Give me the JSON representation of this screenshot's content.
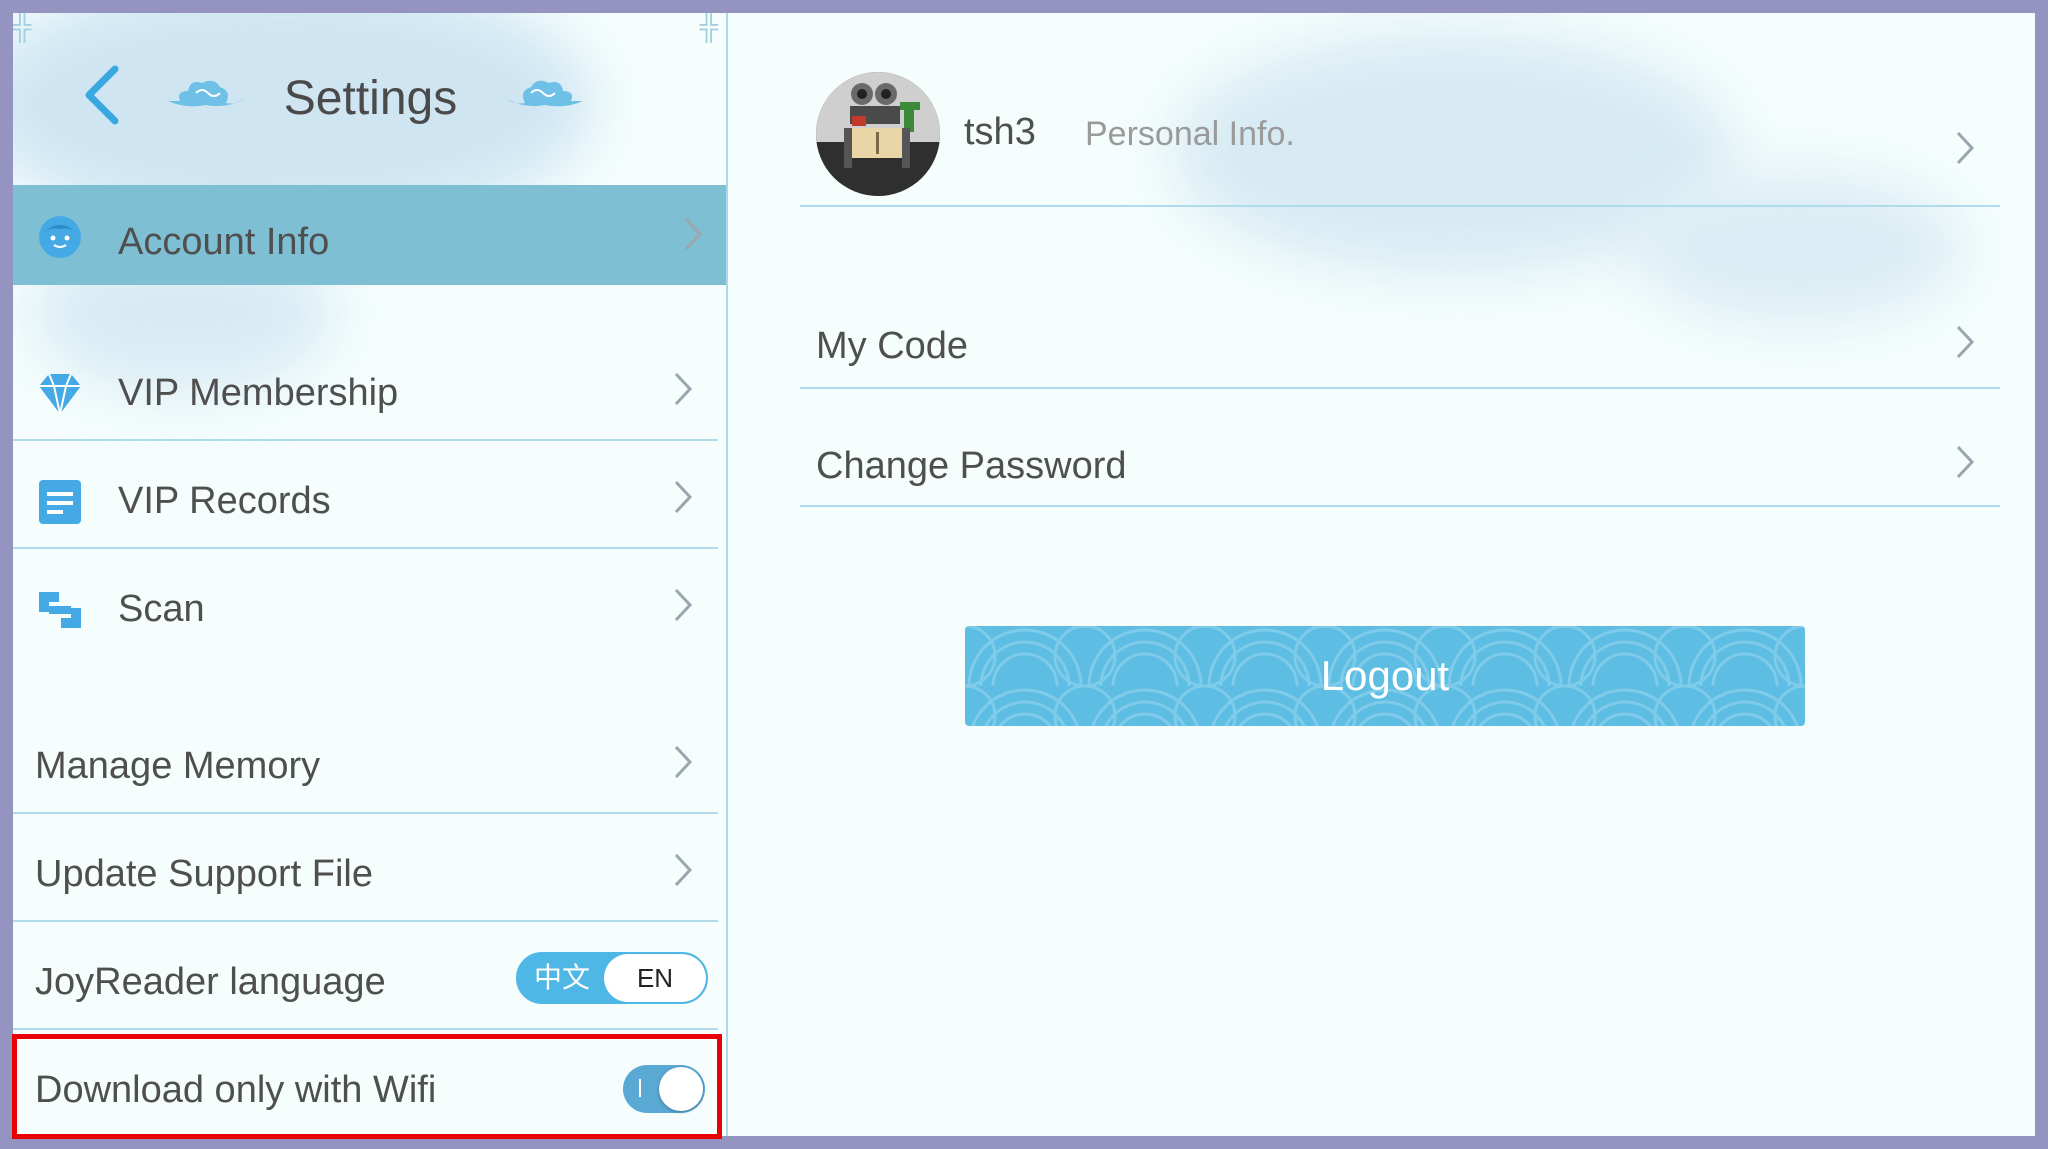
{
  "settings": {
    "title": "Settings",
    "menu": [
      {
        "label": "Account Info",
        "icon": "face-icon"
      },
      {
        "label": "VIP Membership",
        "icon": "diamond-icon"
      },
      {
        "label": "VIP Records",
        "icon": "document-icon"
      },
      {
        "label": "Scan",
        "icon": "scan-icon"
      },
      {
        "label": "Manage Memory"
      },
      {
        "label": "Update Support File"
      },
      {
        "label": "JoyReader language"
      },
      {
        "label": "Download only with Wifi"
      }
    ],
    "language": {
      "options": [
        "中文",
        "EN"
      ],
      "selected": "EN"
    },
    "wifi_only": {
      "on": true,
      "on_mark": "I"
    }
  },
  "account": {
    "username": "tsh3",
    "personal_info": "Personal Info.",
    "items": [
      {
        "label": "My Code"
      },
      {
        "label": "Change Password"
      }
    ],
    "logout_label": "Logout"
  },
  "colors": {
    "accent": "#5ebde3",
    "selected_row": "#7fbfd4",
    "icon_blue": "#45a9e6",
    "highlight_box": "#ea0000",
    "frame": "#9593bf"
  }
}
